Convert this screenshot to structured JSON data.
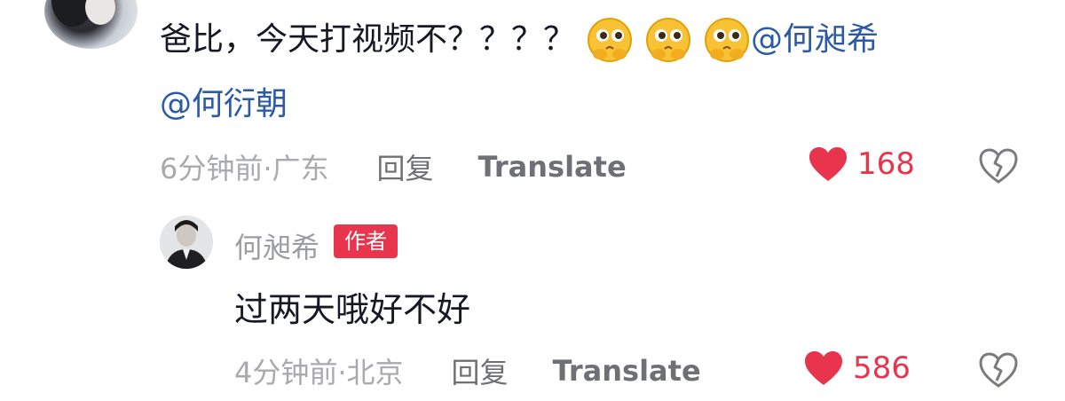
{
  "comment": {
    "text": "爸比，今天打视频不？？？？",
    "emojis": [
      "thinking-face-emoji",
      "thinking-face-emoji",
      "thinking-face-emoji"
    ],
    "mentions": [
      "@何昶希",
      "@何衍朝"
    ],
    "time_location": "6分钟前·广东",
    "reply_label": "回复",
    "translate_label": "Translate",
    "likes": "168"
  },
  "reply": {
    "author": "何昶希",
    "author_badge": "作者",
    "text": "过两天哦好不好",
    "time_location": "4分钟前·北京",
    "reply_label": "回复",
    "translate_label": "Translate",
    "likes": "586"
  },
  "colors": {
    "accent": "#e8344d",
    "mention": "#2b5aa7",
    "muted": "#8a8b91"
  }
}
